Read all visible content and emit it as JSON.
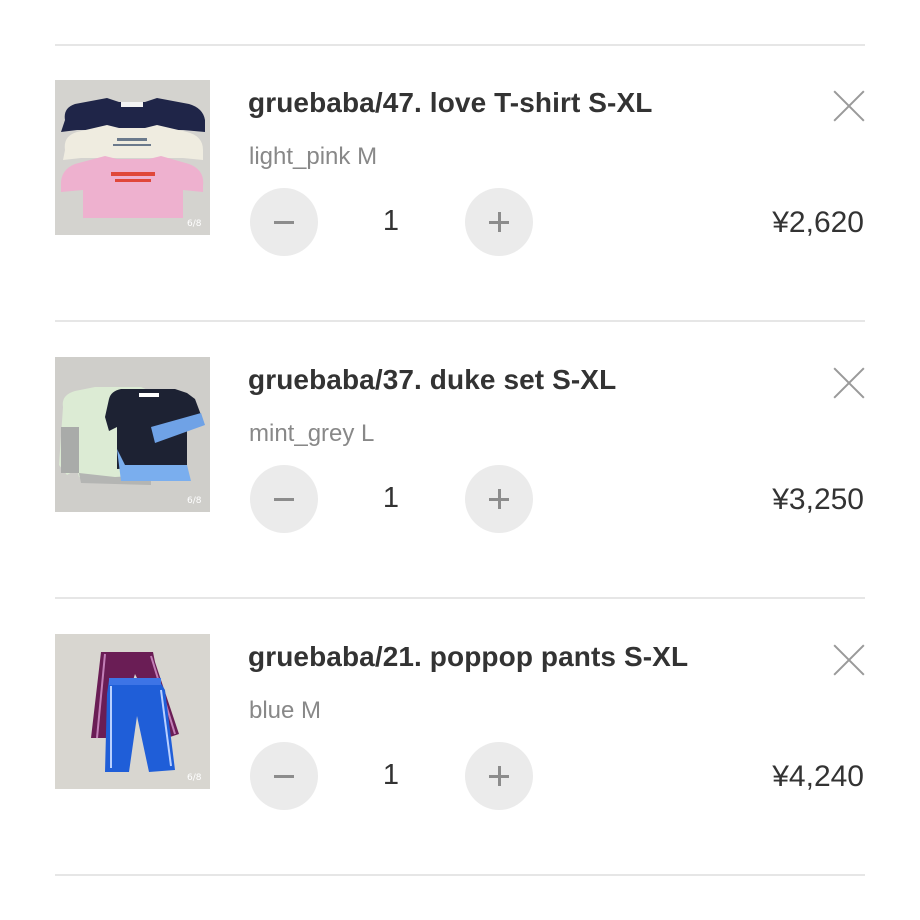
{
  "cart": {
    "items": [
      {
        "title": "gruebaba/47. love T-shirt S-XL",
        "option": "light_pink M",
        "quantity": "1",
        "price": "¥2,620",
        "thumb_badge": "6/8",
        "image": "three-long-sleeve-tshirts-navy-cream-pink"
      },
      {
        "title": "gruebaba/37. duke set S-XL",
        "option": "mint_grey L",
        "quantity": "1",
        "price": "¥3,250",
        "thumb_badge": "6/8",
        "image": "two-tops-mint-grey-and-navy-blue"
      },
      {
        "title": "gruebaba/21. poppop pants S-XL",
        "option": "blue M",
        "quantity": "1",
        "price": "¥4,240",
        "thumb_badge": "6/8",
        "image": "two-track-pants-purple-and-blue"
      }
    ]
  },
  "icons": {
    "remove": "close-icon",
    "decrease": "minus-icon",
    "increase": "plus-icon"
  },
  "colors": {
    "text": "#333333",
    "muted": "#888888",
    "button_bg": "#ebebeb",
    "divider": "#e6e6e6"
  }
}
